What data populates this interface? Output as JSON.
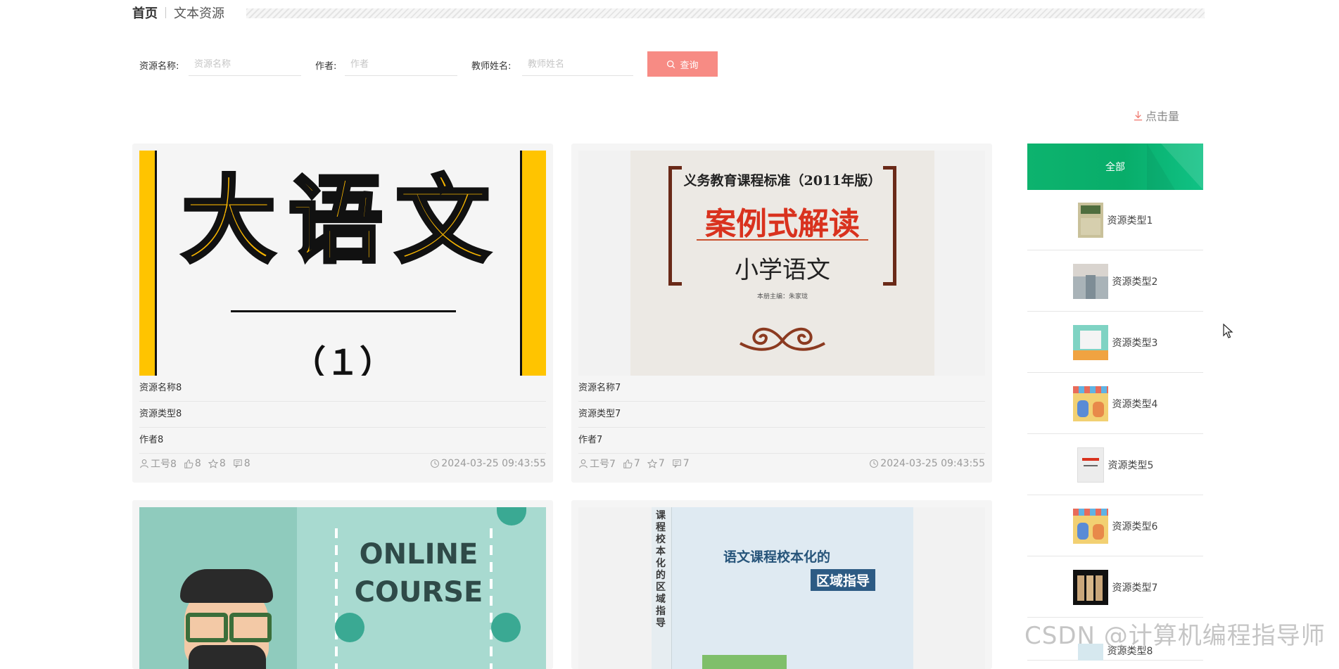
{
  "breadcrumb": {
    "home": "首页",
    "current": "文本资源"
  },
  "search": {
    "name_label": "资源名称:",
    "name_placeholder": "资源名称",
    "author_label": "作者:",
    "author_placeholder": "作者",
    "teacher_label": "教师姓名:",
    "teacher_placeholder": "教师姓名",
    "button_label": "查询"
  },
  "sort": {
    "label": "点击量"
  },
  "cards": [
    {
      "name": "资源名称8",
      "type": "资源类型8",
      "author": "作者8",
      "user": "工号8",
      "likes": "8",
      "favorites": "8",
      "comments": "8",
      "time": "2024-03-25 09:43:55",
      "cover": {
        "title": "大语文",
        "subtitle": "（１）"
      }
    },
    {
      "name": "资源名称7",
      "type": "资源类型7",
      "author": "作者7",
      "user": "工号7",
      "likes": "7",
      "favorites": "7",
      "comments": "7",
      "time": "2024-03-25 09:43:55",
      "cover": {
        "line1": "义务教育课程标准（2011年版）",
        "line2": "案例式解读",
        "line3": "小学语文",
        "line4": "本册主编：朱家珑"
      }
    },
    {
      "cover": {
        "line1": "ONLINE",
        "line2": "COURSE"
      }
    },
    {
      "cover": {
        "spine": "课程校本化的区域指导",
        "line1": "语文课程校本化的",
        "line2": "区域指导"
      }
    }
  ],
  "sidebar": {
    "header": "全部",
    "items": [
      {
        "label": "资源类型1",
        "thumb_color": "#c9c19a"
      },
      {
        "label": "资源类型2",
        "thumb_color": "#a9b3b8"
      },
      {
        "label": "资源类型3",
        "thumb_color": "#7fd3c3"
      },
      {
        "label": "资源类型4",
        "thumb_color": "#f2d072"
      },
      {
        "label": "资源类型5",
        "thumb_color": "#ececec"
      },
      {
        "label": "资源类型6",
        "thumb_color": "#f2d072"
      },
      {
        "label": "资源类型7",
        "thumb_color": "#111111"
      },
      {
        "label": "资源类型8",
        "thumb_color": "#d6e8ef"
      }
    ]
  },
  "watermark": "CSDN @计算机编程指导师",
  "colors": {
    "accent_button": "#f78b84",
    "sidebar_green": "#0db36e",
    "meta_text": "#9a9a9a"
  }
}
